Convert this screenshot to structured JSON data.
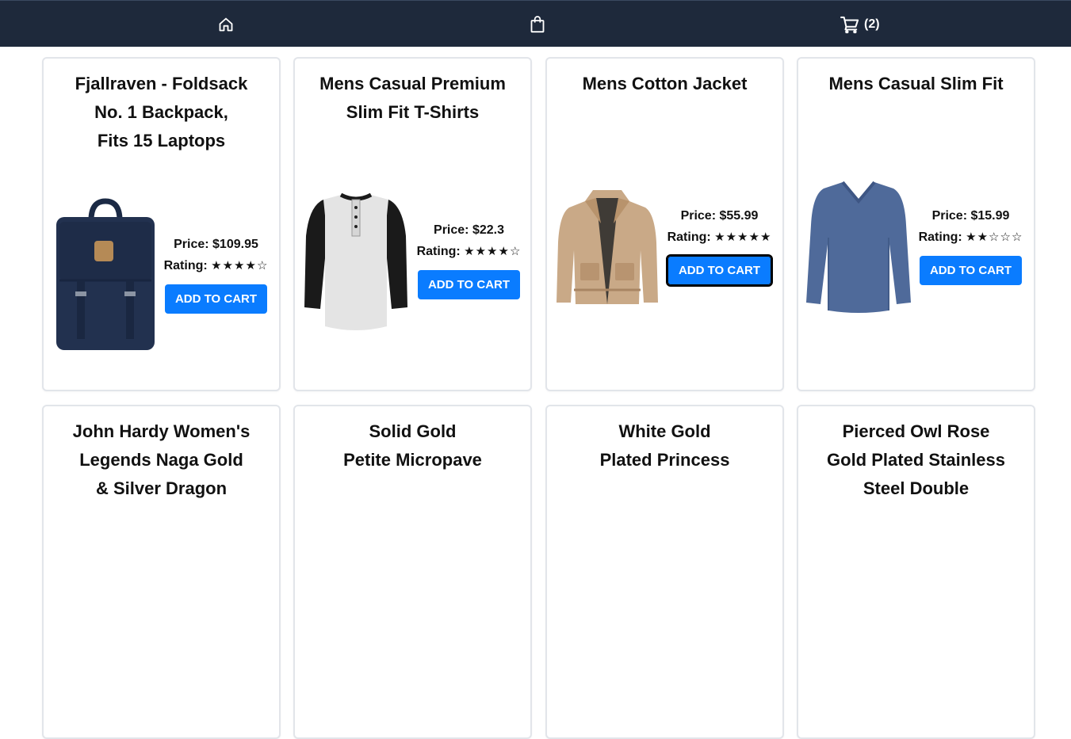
{
  "nav": {
    "home_icon": "home-icon",
    "bag_icon": "shopping-bag-icon",
    "cart_icon": "cart-icon",
    "cart_count": "(2)"
  },
  "labels": {
    "price_prefix": "Price:",
    "rating_prefix": "Rating:",
    "add_to_cart": "ADD TO CART"
  },
  "products": [
    {
      "title": "Fjallraven - Foldsack No. 1 Backpack, Fits 15 Laptops",
      "title_lines": [
        "Fjallraven - Foldsack",
        "No. 1 Backpack,",
        "Fits 15 Laptops"
      ],
      "price": "$109.95",
      "rating_stars": "★★★★☆",
      "rating": 4,
      "image": "navy-backpack"
    },
    {
      "title": "Mens Casual Premium Slim Fit T-Shirts",
      "title_lines": [
        "Mens Casual Premium",
        "Slim Fit T-Shirts"
      ],
      "price": "$22.3",
      "rating_stars": "★★★★☆",
      "rating": 4,
      "image": "raglan-henley-shirt"
    },
    {
      "title": "Mens Cotton Jacket",
      "title_lines": [
        "Mens Cotton Jacket"
      ],
      "price": "$55.99",
      "rating_stars": "★★★★★",
      "rating": 5,
      "image": "tan-cotton-jacket"
    },
    {
      "title": "Mens Casual Slim Fit",
      "title_lines": [
        "Mens Casual Slim Fit"
      ],
      "price": "$15.99",
      "rating_stars": "★★☆☆☆",
      "rating": 2,
      "image": "blue-long-sleeve-shirt"
    },
    {
      "title_lines": [
        "John Hardy Women's",
        "Legends Naga Gold",
        "& Silver Dragon"
      ]
    },
    {
      "title_lines": [
        "Solid Gold",
        "Petite Micropave"
      ]
    },
    {
      "title_lines": [
        "White Gold",
        "Plated Princess"
      ]
    },
    {
      "title_lines": [
        "Pierced Owl Rose",
        "Gold Plated Stainless",
        "Steel Double"
      ]
    }
  ],
  "colors": {
    "nav_bg": "#1e293b",
    "button_bg": "#0a7cff"
  }
}
